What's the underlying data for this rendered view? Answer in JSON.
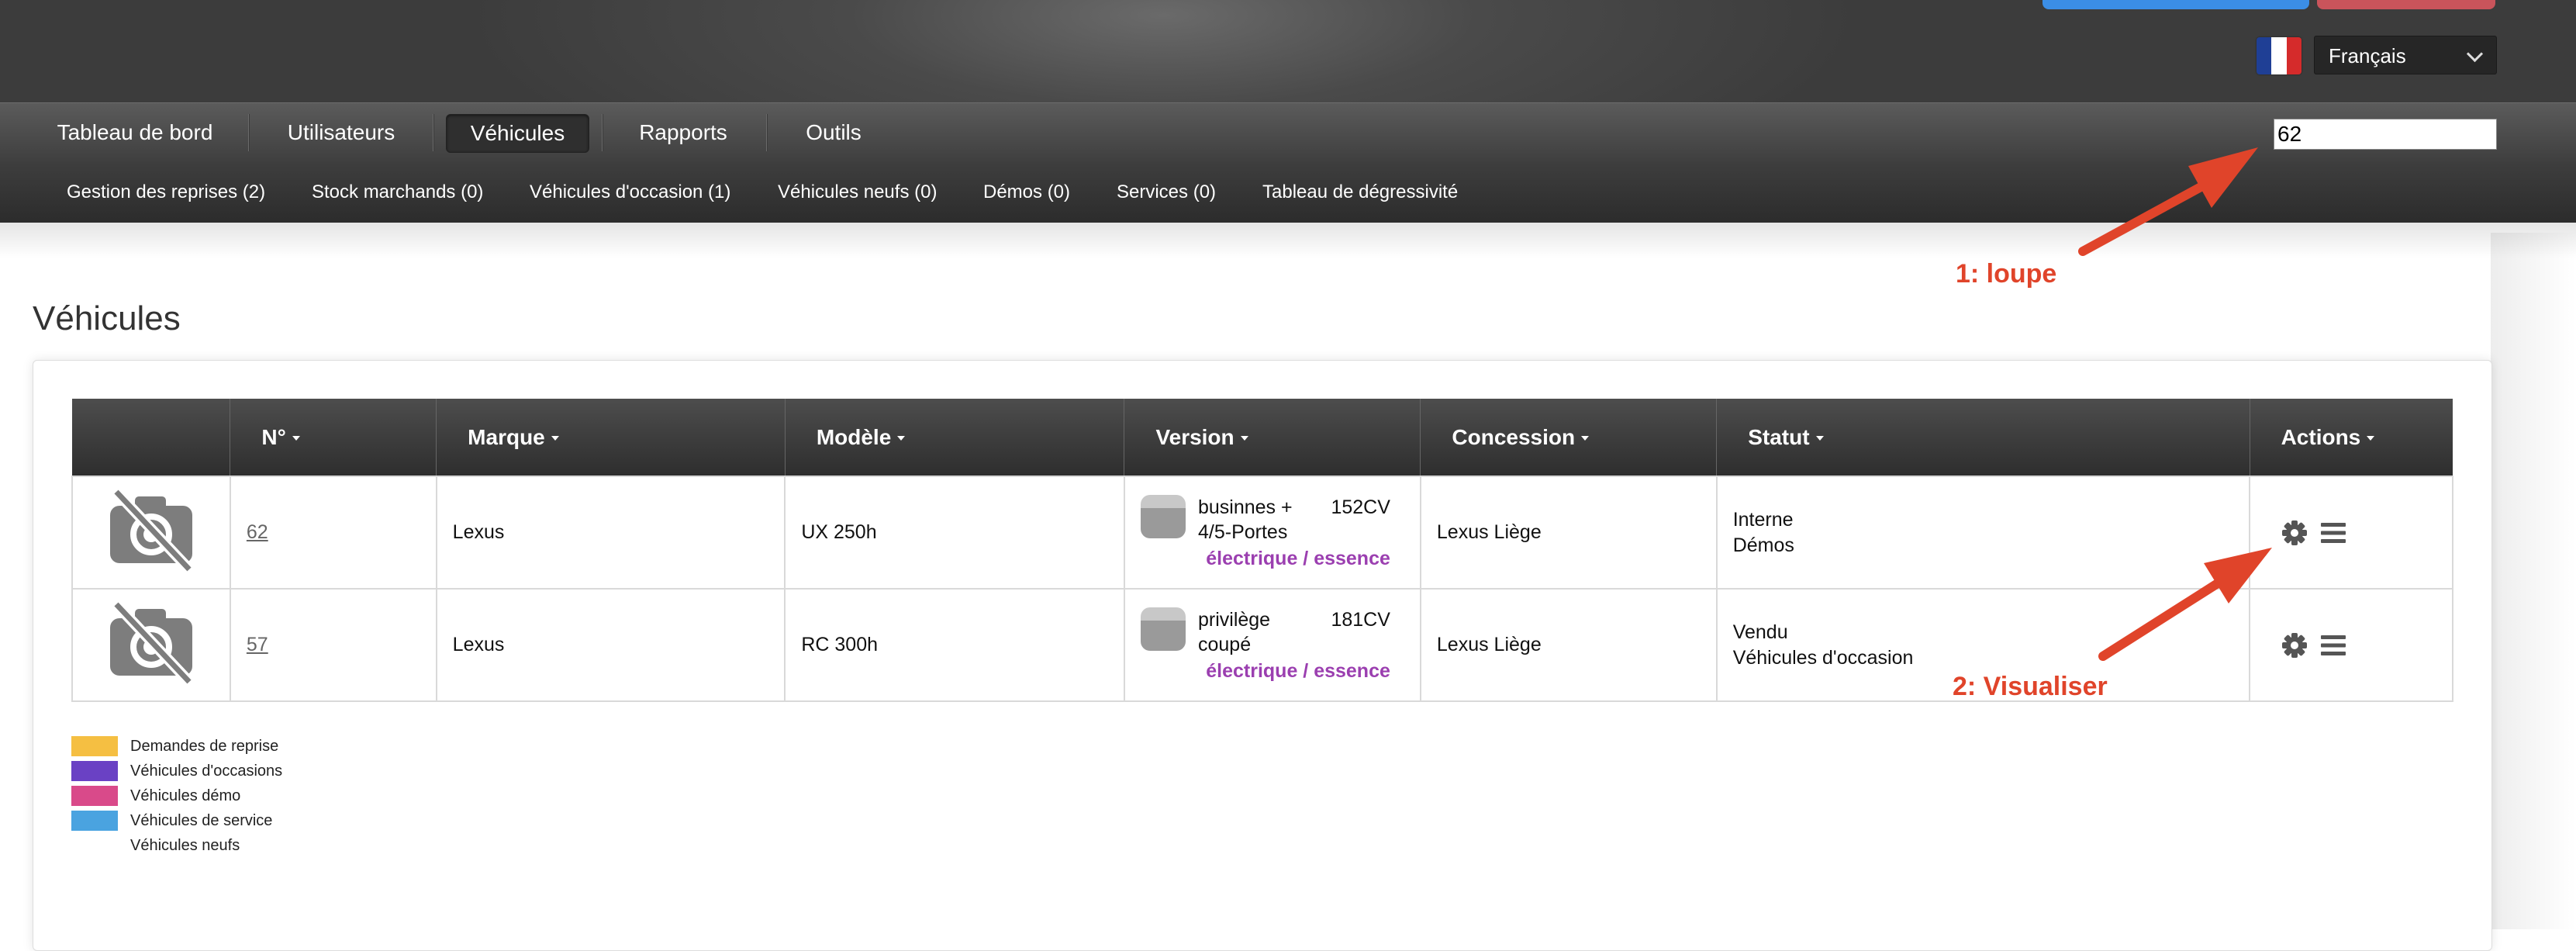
{
  "header": {
    "language": "Français",
    "flag_colors": [
      "#1f3f95",
      "#ffffff",
      "#d52b2b"
    ]
  },
  "nav": {
    "items": [
      {
        "label": "Tableau de bord"
      },
      {
        "label": "Utilisateurs"
      },
      {
        "label": "Véhicules",
        "active": true
      },
      {
        "label": "Rapports"
      },
      {
        "label": "Outils"
      }
    ],
    "search_value": "62"
  },
  "subnav": {
    "items": [
      {
        "label": "Gestion des reprises (2)"
      },
      {
        "label": "Stock marchands (0)"
      },
      {
        "label": "Véhicules d'occasion (1)"
      },
      {
        "label": "Véhicules neufs (0)"
      },
      {
        "label": "Démos (0)"
      },
      {
        "label": "Services (0)"
      },
      {
        "label": "Tableau de dégressivité"
      }
    ]
  },
  "annotations": {
    "loupe": "1: loupe",
    "visualiser": "2: Visualiser",
    "color": "#e0442a"
  },
  "page": {
    "title": "Véhicules"
  },
  "table": {
    "headers": {
      "num": "N°",
      "marque": "Marque",
      "modele": "Modèle",
      "version": "Version",
      "concession": "Concession",
      "statut": "Statut",
      "actions": "Actions"
    },
    "rows": [
      {
        "num": "62",
        "marque": "Lexus",
        "modele": "UX 250h",
        "version_name": "businnes +",
        "version_power": "152CV",
        "version_body": "4/5-Portes",
        "fuel": "électrique / essence",
        "concession": "Lexus Liège",
        "statut_1": "Interne",
        "statut_2": "Démos"
      },
      {
        "num": "57",
        "marque": "Lexus",
        "modele": "RC 300h",
        "version_name": "privilège",
        "version_power": "181CV",
        "version_body": "coupé",
        "fuel": "électrique / essence",
        "concession": "Lexus Liège",
        "statut_1": "Vendu",
        "statut_2": "Véhicules d'occasion"
      }
    ]
  },
  "legend": [
    {
      "label": "Demandes de reprise",
      "color": "#f5bf42"
    },
    {
      "label": "Véhicules d'occasions",
      "color": "#6a41c4"
    },
    {
      "label": "Véhicules démo",
      "color": "#d94a8a"
    },
    {
      "label": "Véhicules de service",
      "color": "#4aa3e0"
    },
    {
      "label": "Véhicules neufs",
      "color": "#ffffff"
    }
  ]
}
